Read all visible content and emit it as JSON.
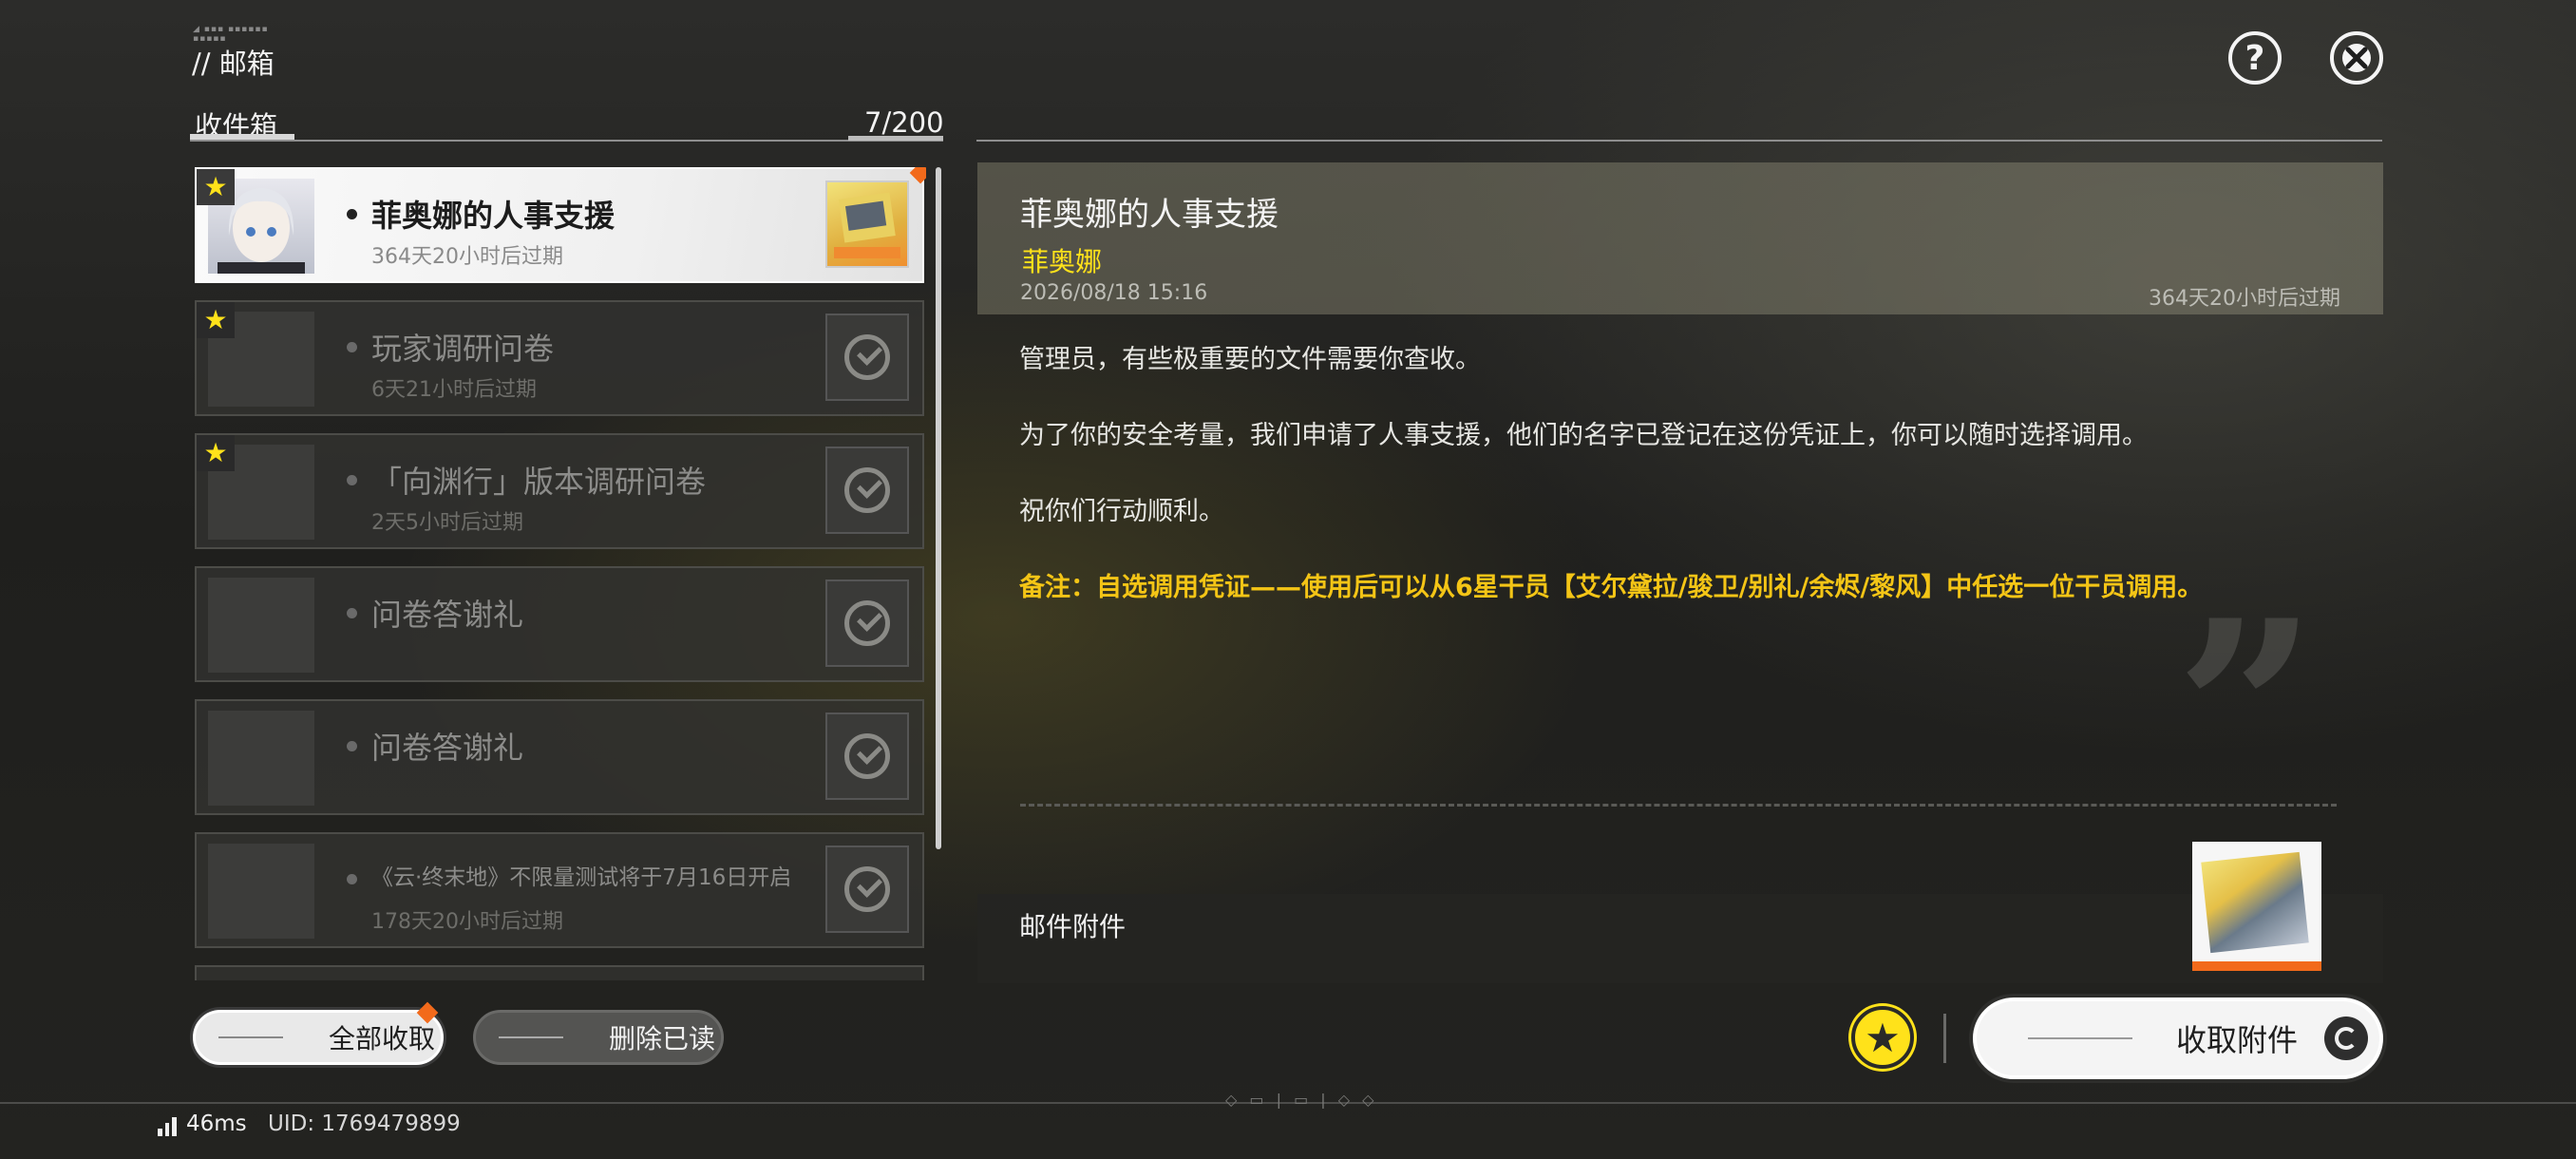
{
  "header": {
    "breadcrumb": "// 邮箱",
    "help_label": "?",
    "close_label": "✕"
  },
  "inbox": {
    "title": "收件箱",
    "count": "7/200",
    "mails": [
      {
        "title": "菲奥娜的人事支援",
        "expire": "364天20小时后过期",
        "starred": true,
        "selected": true,
        "unread": true
      },
      {
        "title": "玩家调研问卷",
        "expire": "6天21小时后过期",
        "starred": true,
        "selected": false
      },
      {
        "title": "「向渊行」版本调研问卷",
        "expire": "2天5小时后过期",
        "starred": true,
        "selected": false
      },
      {
        "title": "问卷答谢礼",
        "expire": "",
        "starred": false,
        "selected": false
      },
      {
        "title": "问卷答谢礼",
        "expire": "",
        "starred": false,
        "selected": false
      },
      {
        "title": "《云·终末地》不限量测试将于7月16日开启",
        "expire": "178天20小时后过期",
        "starred": false,
        "selected": false
      }
    ]
  },
  "actions": {
    "claim_all": "全部收取",
    "delete_read": "删除已读",
    "claim_attachment": "收取附件"
  },
  "detail": {
    "title": "菲奥娜的人事支援",
    "sender": "菲奥娜",
    "date": "2026/08/18 15:16",
    "expire": "364天20小时后过期",
    "paragraphs": [
      "管理员，有些极重要的文件需要你查收。",
      "为了你的安全考量，我们申请了人事支援，他们的名字已登记在这份凭证上，你可以随时选择调用。",
      "祝你们行动顺利。"
    ],
    "note": "备注：自选调用凭证——使用后可以从6星干员【艾尔黛拉/骏卫/别礼/余烬/黎风】中任选一位干员调用。",
    "attachments_label": "邮件附件"
  },
  "status": {
    "ping": "46ms",
    "uid": "UID: 1769479899"
  },
  "colors": {
    "accent_yellow": "#ffe21a",
    "note_yellow": "#f4c516",
    "unread_orange": "#f26a1b"
  }
}
